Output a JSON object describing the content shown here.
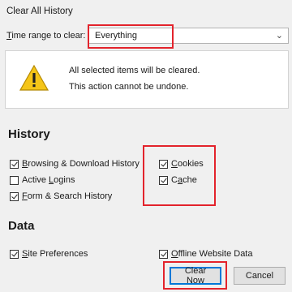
{
  "window": {
    "title": "Clear All History"
  },
  "time_range": {
    "label_underlined": "T",
    "label_rest": "ime range to clear:",
    "selected": "Everything"
  },
  "warning": {
    "line1": "All selected items will be cleared.",
    "line2": "This action cannot be undone."
  },
  "history": {
    "heading": "History",
    "items": [
      {
        "u": "B",
        "rest": "rowsing & Download History",
        "checked": true
      },
      {
        "u": "",
        "rest": "Active ",
        "u2": "L",
        "rest2": "ogins",
        "checked": false
      },
      {
        "u": "F",
        "rest": "orm & Search History",
        "checked": true
      },
      {
        "u": "C",
        "rest": "ookies",
        "checked": true
      },
      {
        "u": "",
        "rest": "C",
        "u2": "a",
        "rest2": "che",
        "checked": true
      }
    ]
  },
  "data": {
    "heading": "Data",
    "items": [
      {
        "u": "S",
        "rest": "ite Preferences",
        "checked": true
      },
      {
        "u": "O",
        "rest": "ffline Website Data",
        "checked": true
      }
    ]
  },
  "buttons": {
    "clear_now": "Clear Now",
    "cancel": "Cancel"
  },
  "colors": {
    "highlight": "#e3232c",
    "default_button": "#0078d7",
    "warning_yellow": "#f5c518"
  }
}
